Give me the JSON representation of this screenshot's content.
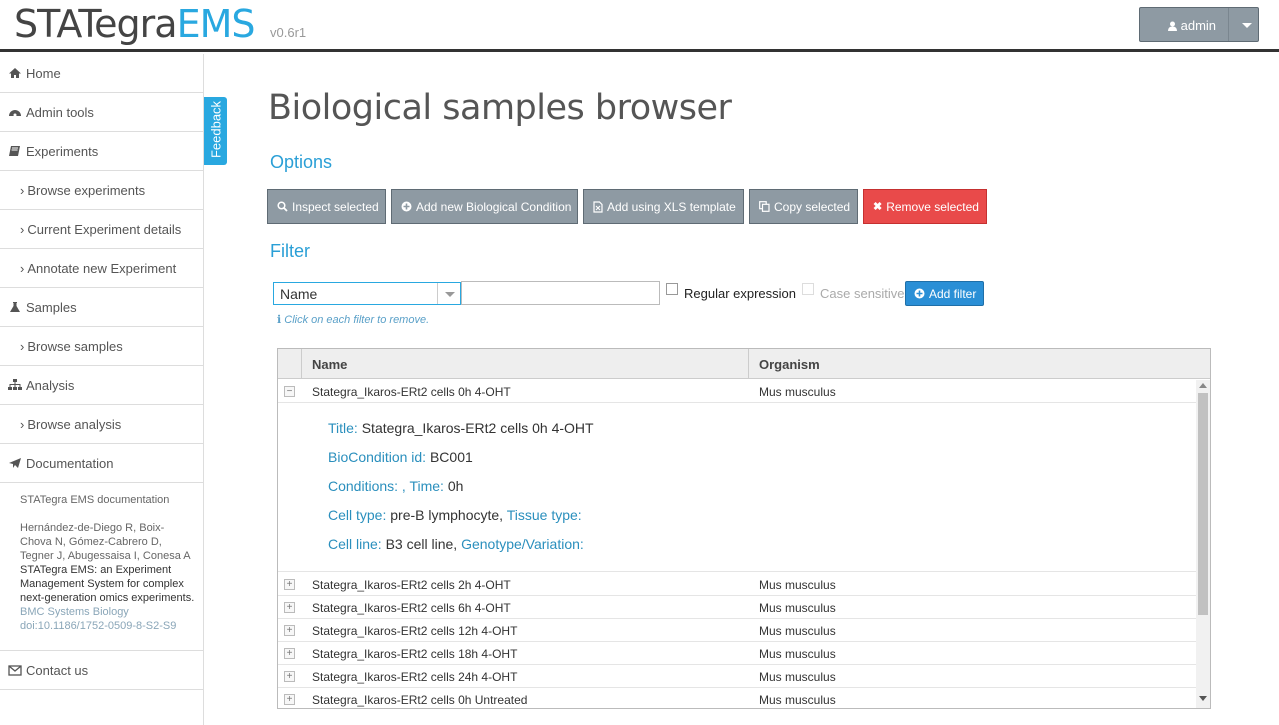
{
  "header": {
    "logo_main": "STATegra",
    "logo_accent": "EMS",
    "version": "v0.6r1",
    "user_label": "admin"
  },
  "sidebar": {
    "items": [
      {
        "label": "Home",
        "icon": "home-icon"
      },
      {
        "label": "Admin tools",
        "icon": "dashboard-icon"
      },
      {
        "label": "Experiments",
        "icon": "book-icon"
      },
      {
        "label": "Browse experiments",
        "icon": "chevron-right-icon"
      },
      {
        "label": "Current Experiment details",
        "icon": "chevron-right-icon"
      },
      {
        "label": "Annotate new Experiment",
        "icon": "chevron-right-icon"
      },
      {
        "label": "Samples",
        "icon": "flask-icon"
      },
      {
        "label": "Browse samples",
        "icon": "chevron-right-icon"
      },
      {
        "label": "Analysis",
        "icon": "sitemap-icon"
      },
      {
        "label": "Browse analysis",
        "icon": "chevron-right-icon"
      },
      {
        "label": "Documentation",
        "icon": "paper-plane-icon"
      },
      {
        "label": "Contact us",
        "icon": "envelope-icon"
      }
    ],
    "doc_link": "STATegra EMS documentation",
    "citation": {
      "authors": "Hernández-de-Diego R, Boix-Chova N, Gómez-Cabrero D, Tegner J, Abugessaisa I, Conesa A",
      "title": "STATegra EMS: an Experiment Management System for complex next-generation omics experiments.",
      "journal": "BMC Systems Biology doi:10.1186/1752-0509-8-S2-S9"
    }
  },
  "feedback_label": "Feedback",
  "main": {
    "title": "Biological samples browser",
    "options_heading": "Options",
    "filter_heading": "Filter",
    "buttons": {
      "inspect": "Inspect selected",
      "add_new": "Add new Biological Condition",
      "add_xls": "Add using XLS template",
      "copy": "Copy selected",
      "remove": "Remove selected"
    },
    "filter": {
      "field_value": "Name",
      "text_value": "",
      "regex_label": "Regular expression",
      "case_label": "Case sensitive",
      "add_label": "Add filter",
      "hint": "Click on each filter to remove."
    }
  },
  "grid": {
    "columns": [
      "Name",
      "Organism"
    ],
    "rows": [
      {
        "name": "Stategra_Ikaros-ERt2 cells 0h 4-OHT",
        "organism": "Mus musculus",
        "expanded": true
      },
      {
        "name": "Stategra_Ikaros-ERt2 cells 2h 4-OHT",
        "organism": "Mus musculus",
        "expanded": false
      },
      {
        "name": "Stategra_Ikaros-ERt2 cells 6h 4-OHT",
        "organism": "Mus musculus",
        "expanded": false
      },
      {
        "name": "Stategra_Ikaros-ERt2 cells 12h 4-OHT",
        "organism": "Mus musculus",
        "expanded": false
      },
      {
        "name": "Stategra_Ikaros-ERt2 cells 18h 4-OHT",
        "organism": "Mus musculus",
        "expanded": false
      },
      {
        "name": "Stategra_Ikaros-ERt2 cells 24h 4-OHT",
        "organism": "Mus musculus",
        "expanded": false
      },
      {
        "name": "Stategra_Ikaros-ERt2 cells 0h Untreated",
        "organism": "Mus musculus",
        "expanded": false
      }
    ],
    "detail": {
      "title_key": "Title:",
      "title_val": "Stategra_Ikaros-ERt2 cells 0h 4-OHT",
      "bioid_key": "BioCondition id:",
      "bioid_val": "BC001",
      "cond_key": "Conditions: , Time:",
      "cond_val": "0h",
      "cell_key": "Cell type:",
      "cell_val": "pre-B lymphocyte,",
      "tissue_key": "Tissue type:",
      "line_key": "Cell line:",
      "line_val": "B3 cell line,",
      "geno_key": "Genotype/Variation:"
    }
  }
}
